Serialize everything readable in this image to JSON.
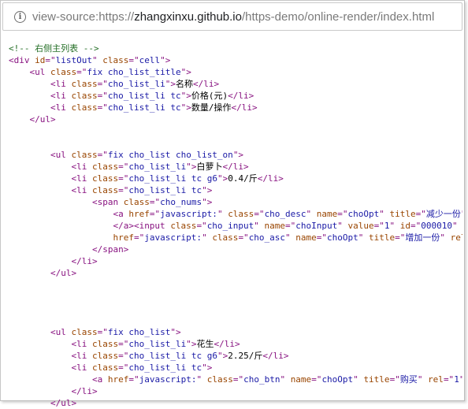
{
  "address_bar": {
    "scheme_prefix": "view-source:https://",
    "host": "zhangxinxu.github.io",
    "path": "/https-demo/online-render/index.html"
  },
  "source_lines": [
    {
      "indent": 0,
      "tokens": [
        [
          "c",
          "<!-- 右侧主列表 -->"
        ]
      ]
    },
    {
      "indent": 0,
      "tokens": [
        [
          "t",
          "<div "
        ],
        [
          "a",
          "id"
        ],
        [
          "t",
          "=\""
        ],
        [
          "v",
          "listOut"
        ],
        [
          "t",
          "\" "
        ],
        [
          "a",
          "class"
        ],
        [
          "t",
          "=\""
        ],
        [
          "v",
          "cell"
        ],
        [
          "t",
          "\">"
        ]
      ]
    },
    {
      "indent": 4,
      "tokens": [
        [
          "t",
          "<ul "
        ],
        [
          "a",
          "class"
        ],
        [
          "t",
          "=\""
        ],
        [
          "v",
          "fix cho_list_title"
        ],
        [
          "t",
          "\">"
        ]
      ]
    },
    {
      "indent": 8,
      "tokens": [
        [
          "t",
          "<li "
        ],
        [
          "a",
          "class"
        ],
        [
          "t",
          "=\""
        ],
        [
          "v",
          "cho_list_li"
        ],
        [
          "t",
          "\">"
        ],
        [
          "x",
          "名称"
        ],
        [
          "t",
          "</li>"
        ]
      ]
    },
    {
      "indent": 8,
      "tokens": [
        [
          "t",
          "<li "
        ],
        [
          "a",
          "class"
        ],
        [
          "t",
          "=\""
        ],
        [
          "v",
          "cho_list_li tc"
        ],
        [
          "t",
          "\">"
        ],
        [
          "x",
          "价格(元)"
        ],
        [
          "t",
          "</li>"
        ]
      ]
    },
    {
      "indent": 8,
      "tokens": [
        [
          "t",
          "<li "
        ],
        [
          "a",
          "class"
        ],
        [
          "t",
          "=\""
        ],
        [
          "v",
          "cho_list_li tc"
        ],
        [
          "t",
          "\">"
        ],
        [
          "x",
          "数量/操作"
        ],
        [
          "t",
          "</li>"
        ]
      ]
    },
    {
      "indent": 4,
      "tokens": [
        [
          "t",
          "</ul>"
        ]
      ]
    },
    {
      "indent": 0,
      "tokens": []
    },
    {
      "indent": 0,
      "tokens": []
    },
    {
      "indent": 8,
      "tokens": [
        [
          "t",
          "<ul "
        ],
        [
          "a",
          "class"
        ],
        [
          "t",
          "=\""
        ],
        [
          "v",
          "fix cho_list cho_list_on"
        ],
        [
          "t",
          "\">"
        ]
      ]
    },
    {
      "indent": 12,
      "tokens": [
        [
          "t",
          "<li "
        ],
        [
          "a",
          "class"
        ],
        [
          "t",
          "=\""
        ],
        [
          "v",
          "cho_list_li"
        ],
        [
          "t",
          "\">"
        ],
        [
          "x",
          "白萝卜"
        ],
        [
          "t",
          "</li>"
        ]
      ]
    },
    {
      "indent": 12,
      "tokens": [
        [
          "t",
          "<li "
        ],
        [
          "a",
          "class"
        ],
        [
          "t",
          "=\""
        ],
        [
          "v",
          "cho_list_li tc g6"
        ],
        [
          "t",
          "\">"
        ],
        [
          "x",
          "0.4/斤"
        ],
        [
          "t",
          "</li>"
        ]
      ]
    },
    {
      "indent": 12,
      "tokens": [
        [
          "t",
          "<li "
        ],
        [
          "a",
          "class"
        ],
        [
          "t",
          "=\""
        ],
        [
          "v",
          "cho_list_li tc"
        ],
        [
          "t",
          "\">"
        ]
      ]
    },
    {
      "indent": 16,
      "tokens": [
        [
          "t",
          "<span "
        ],
        [
          "a",
          "class"
        ],
        [
          "t",
          "=\""
        ],
        [
          "v",
          "cho_nums"
        ],
        [
          "t",
          "\">"
        ]
      ]
    },
    {
      "indent": 20,
      "tokens": [
        [
          "t",
          "<a "
        ],
        [
          "a",
          "href"
        ],
        [
          "t",
          "=\""
        ],
        [
          "v",
          "javascript:"
        ],
        [
          "t",
          "\" "
        ],
        [
          "a",
          "class"
        ],
        [
          "t",
          "=\""
        ],
        [
          "v",
          "cho_desc"
        ],
        [
          "t",
          "\" "
        ],
        [
          "a",
          "name"
        ],
        [
          "t",
          "=\""
        ],
        [
          "v",
          "choOpt"
        ],
        [
          "t",
          "\" "
        ],
        [
          "a",
          "title"
        ],
        [
          "t",
          "=\""
        ],
        [
          "v",
          "减少一份"
        ],
        [
          "t",
          "\""
        ]
      ]
    },
    {
      "indent": 20,
      "tokens": [
        [
          "t",
          "</a><input "
        ],
        [
          "a",
          "class"
        ],
        [
          "t",
          "=\""
        ],
        [
          "v",
          "cho_input"
        ],
        [
          "t",
          "\" "
        ],
        [
          "a",
          "name"
        ],
        [
          "t",
          "=\""
        ],
        [
          "v",
          "choInput"
        ],
        [
          "t",
          "\" "
        ],
        [
          "a",
          "value"
        ],
        [
          "t",
          "=\""
        ],
        [
          "v",
          "1"
        ],
        [
          "t",
          "\" "
        ],
        [
          "a",
          "id"
        ],
        [
          "t",
          "=\""
        ],
        [
          "v",
          "000010"
        ],
        [
          "t",
          "\" "
        ],
        [
          "a",
          "ti"
        ]
      ]
    },
    {
      "indent": 20,
      "tokens": [
        [
          "a",
          "href"
        ],
        [
          "t",
          "=\""
        ],
        [
          "v",
          "javascript:"
        ],
        [
          "t",
          "\" "
        ],
        [
          "a",
          "class"
        ],
        [
          "t",
          "=\""
        ],
        [
          "v",
          "cho_asc"
        ],
        [
          "t",
          "\" "
        ],
        [
          "a",
          "name"
        ],
        [
          "t",
          "=\""
        ],
        [
          "v",
          "choOpt"
        ],
        [
          "t",
          "\" "
        ],
        [
          "a",
          "title"
        ],
        [
          "t",
          "=\""
        ],
        [
          "v",
          "增加一份"
        ],
        [
          "t",
          "\" "
        ],
        [
          "a",
          "rel"
        ]
      ]
    },
    {
      "indent": 16,
      "tokens": [
        [
          "t",
          "</span>"
        ]
      ]
    },
    {
      "indent": 12,
      "tokens": [
        [
          "t",
          "</li>"
        ]
      ]
    },
    {
      "indent": 8,
      "tokens": [
        [
          "t",
          "</ul>"
        ]
      ]
    },
    {
      "indent": 0,
      "tokens": []
    },
    {
      "indent": 0,
      "tokens": []
    },
    {
      "indent": 0,
      "tokens": []
    },
    {
      "indent": 0,
      "tokens": []
    },
    {
      "indent": 8,
      "tokens": [
        [
          "t",
          "<ul "
        ],
        [
          "a",
          "class"
        ],
        [
          "t",
          "=\""
        ],
        [
          "v",
          "fix cho_list"
        ],
        [
          "t",
          "\">"
        ]
      ]
    },
    {
      "indent": 12,
      "tokens": [
        [
          "t",
          "<li "
        ],
        [
          "a",
          "class"
        ],
        [
          "t",
          "=\""
        ],
        [
          "v",
          "cho_list_li"
        ],
        [
          "t",
          "\">"
        ],
        [
          "x",
          "花生"
        ],
        [
          "t",
          "</li>"
        ]
      ]
    },
    {
      "indent": 12,
      "tokens": [
        [
          "t",
          "<li "
        ],
        [
          "a",
          "class"
        ],
        [
          "t",
          "=\""
        ],
        [
          "v",
          "cho_list_li tc g6"
        ],
        [
          "t",
          "\">"
        ],
        [
          "x",
          "2.25/斤"
        ],
        [
          "t",
          "</li>"
        ]
      ]
    },
    {
      "indent": 12,
      "tokens": [
        [
          "t",
          "<li "
        ],
        [
          "a",
          "class"
        ],
        [
          "t",
          "=\""
        ],
        [
          "v",
          "cho_list_li tc"
        ],
        [
          "t",
          "\">"
        ]
      ]
    },
    {
      "indent": 16,
      "tokens": [
        [
          "t",
          "<a "
        ],
        [
          "a",
          "href"
        ],
        [
          "t",
          "=\""
        ],
        [
          "v",
          "javascript:"
        ],
        [
          "t",
          "\" "
        ],
        [
          "a",
          "class"
        ],
        [
          "t",
          "=\""
        ],
        [
          "v",
          "cho_btn"
        ],
        [
          "t",
          "\" "
        ],
        [
          "a",
          "name"
        ],
        [
          "t",
          "=\""
        ],
        [
          "v",
          "choOpt"
        ],
        [
          "t",
          "\" "
        ],
        [
          "a",
          "title"
        ],
        [
          "t",
          "=\""
        ],
        [
          "v",
          "购买"
        ],
        [
          "t",
          "\" "
        ],
        [
          "a",
          "rel"
        ],
        [
          "t",
          "=\""
        ],
        [
          "v",
          "1"
        ],
        [
          "t",
          "\""
        ]
      ]
    },
    {
      "indent": 12,
      "tokens": [
        [
          "t",
          "</li>"
        ]
      ]
    },
    {
      "indent": 8,
      "tokens": [
        [
          "t",
          "</ul>"
        ]
      ]
    }
  ],
  "colors": {
    "tag": "#881280",
    "attribute": "#994500",
    "value": "#1a1aa6",
    "comment": "#236e25",
    "text": "#000000"
  },
  "icons": {
    "address_info": "info-circle-icon"
  }
}
